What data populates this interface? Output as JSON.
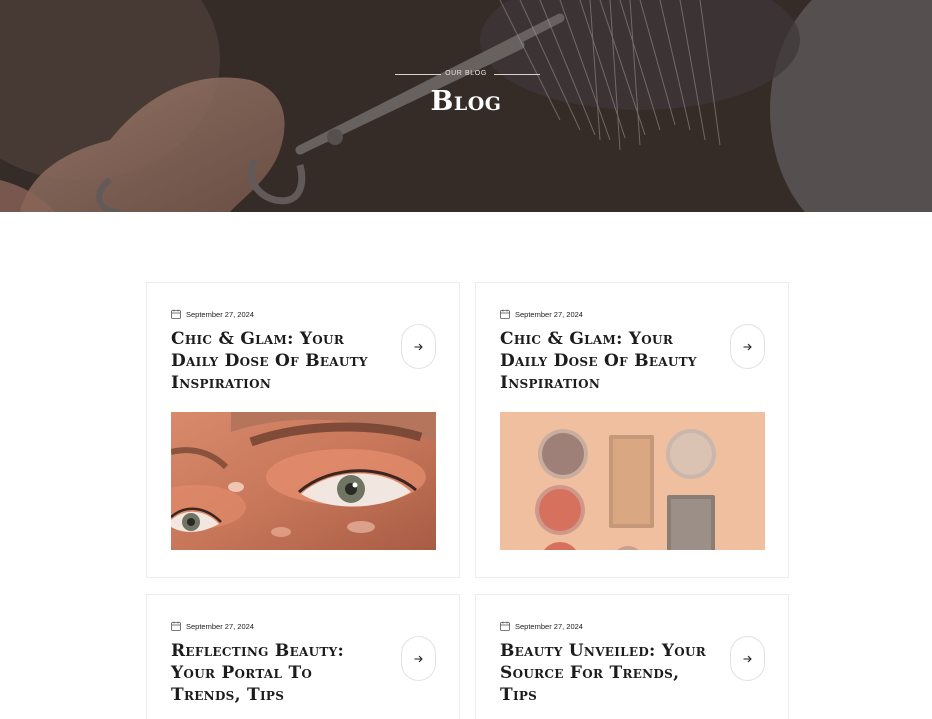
{
  "hero": {
    "kicker": "Our Blog",
    "title": "Blog"
  },
  "posts": [
    {
      "date": "September 27, 2024",
      "title": "Chic & Glam: Your Daily Dose Of Beauty Inspiration",
      "image": "eye-makeup-closeup"
    },
    {
      "date": "September 27, 2024",
      "title": "Chic & Glam: Your Daily Dose Of Beauty Inspiration",
      "image": "eyeshadow-palette-flatlay"
    },
    {
      "date": "September 27, 2024",
      "title": "Reflecting Beauty: Your Portal To Trends, Tips",
      "image": ""
    },
    {
      "date": "September 27, 2024",
      "title": "Beauty Unveiled: Your Source For Trends, Tips",
      "image": ""
    }
  ],
  "icons": {
    "date": "calendar-icon",
    "read_more": "arrow-right-icon"
  }
}
